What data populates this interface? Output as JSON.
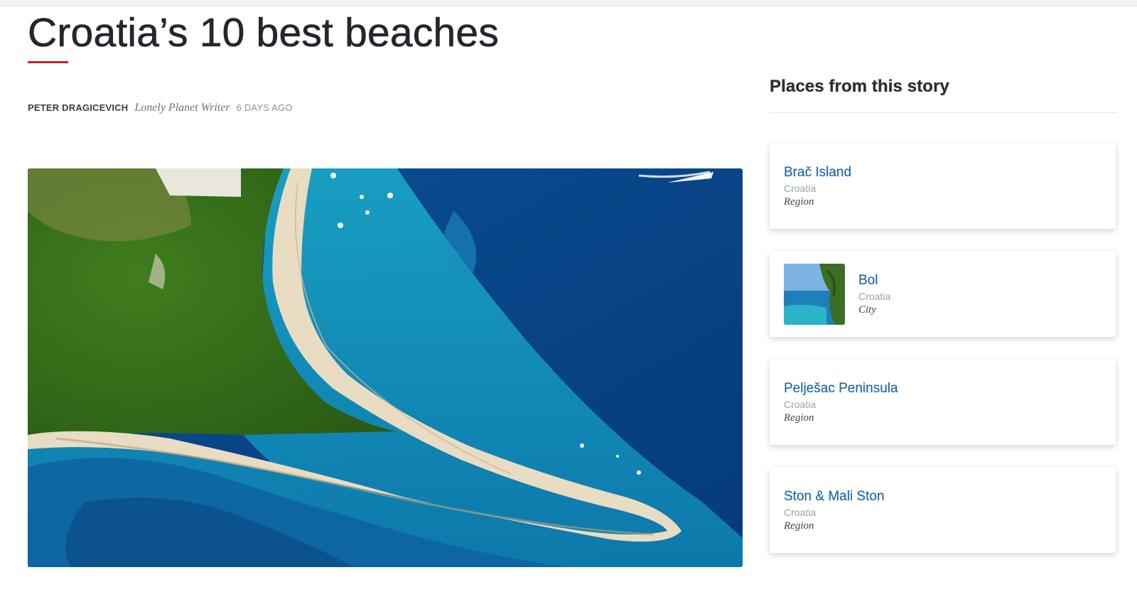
{
  "article": {
    "title": "Croatia’s 10 best beaches",
    "author": "PETER DRAGICEVICH",
    "author_role": "Lonely Planet Writer",
    "published": "6 DAYS AGO",
    "accent_color": "#c8202f"
  },
  "hero_image": {
    "subject": "aerial view of a sandy beach spit with pine forest and turquoise sea"
  },
  "sidebar": {
    "title": "Places from this story",
    "places": [
      {
        "name": "Brač Island",
        "country": "Croatia",
        "type": "Region",
        "has_thumbnail": false
      },
      {
        "name": "Bol",
        "country": "Croatia",
        "type": "City",
        "has_thumbnail": true
      },
      {
        "name": "Pelješac Peninsula",
        "country": "Croatia",
        "type": "Region",
        "has_thumbnail": false
      },
      {
        "name": "Ston & Mali Ston",
        "country": "Croatia",
        "type": "Region",
        "has_thumbnail": false
      }
    ],
    "link_color": "#1f6aa8"
  }
}
